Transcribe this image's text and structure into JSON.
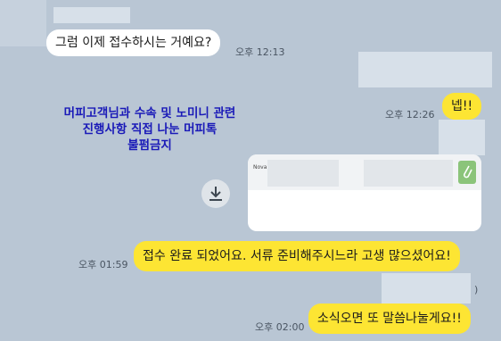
{
  "messages": {
    "m1": {
      "text": "그럼 이제 접수하시는 거예요?",
      "time": "오후 12:13"
    },
    "m2": {
      "text": "넵!!",
      "time": "오후 12:26"
    },
    "m3": {
      "text": "접수 완료 되었어요. 서류 준비해주시느라 고생 많으셨어요!",
      "time": "오후 01:59"
    },
    "m4": {
      "text": "소식오면 또 말씀나눌게요!!",
      "time": "오후 02:00"
    }
  },
  "watermark": {
    "line1": "머피고객님과 수속 및 노미니 관련",
    "line2": "진행사항 직접 나눈 머피톡",
    "line3": "불펌금지"
  },
  "file": {
    "name_snippet": "Nova",
    "icons": {
      "download": "download-icon",
      "attachment": "paperclip-icon"
    }
  },
  "colors": {
    "background": "#b9c6d4",
    "own_bubble": "#fde533",
    "other_bubble": "#ffffff",
    "watermark": "#1a1ab8"
  }
}
